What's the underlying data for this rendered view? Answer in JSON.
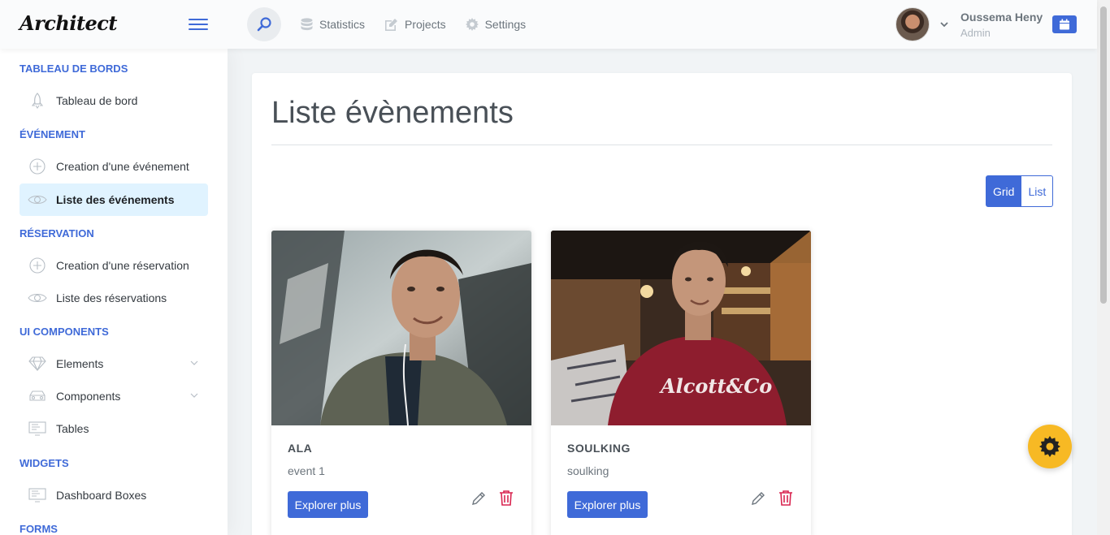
{
  "app": {
    "logo": "Architect"
  },
  "header": {
    "nav": [
      {
        "label": "Statistics",
        "icon": "database-icon"
      },
      {
        "label": "Projects",
        "icon": "edit-icon"
      },
      {
        "label": "Settings",
        "icon": "gear-icon"
      }
    ],
    "user": {
      "name": "Oussema Heny",
      "role": "Admin"
    }
  },
  "sidebar": {
    "sections": [
      {
        "title": "TABLEAU DE BORDS",
        "items": [
          {
            "label": "Tableau de bord",
            "icon": "rocket-icon"
          }
        ]
      },
      {
        "title": "ÉVÉNEMENT",
        "items": [
          {
            "label": "Creation d'une événement",
            "icon": "plus-circle-icon"
          },
          {
            "label": "Liste des événements",
            "icon": "eye-icon",
            "active": true
          }
        ]
      },
      {
        "title": "RÉSERVATION",
        "items": [
          {
            "label": "Creation d'une réservation",
            "icon": "plus-circle-icon"
          },
          {
            "label": "Liste des réservations",
            "icon": "eye-icon"
          }
        ]
      },
      {
        "title": "UI COMPONENTS",
        "items": [
          {
            "label": "Elements",
            "icon": "diamond-icon"
          },
          {
            "label": "Components",
            "icon": "car-icon"
          },
          {
            "label": "Tables",
            "icon": "monitor-icon"
          }
        ]
      },
      {
        "title": "WIDGETS",
        "items": [
          {
            "label": "Dashboard Boxes",
            "icon": "monitor-icon"
          }
        ]
      },
      {
        "title": "FORMS",
        "items": []
      }
    ]
  },
  "main": {
    "title": "Liste évènements",
    "view_toggle": {
      "grid": "Grid",
      "list": "List",
      "selected": "Grid"
    },
    "events": [
      {
        "name": "ALA",
        "description": "event 1",
        "button": "Explorer plus"
      },
      {
        "name": "SOULKING",
        "description": "soulking",
        "button": "Explorer plus"
      }
    ]
  },
  "colors": {
    "accent": "#3f6ad8",
    "active_bg": "#e0f3ff",
    "fab": "#f7b924",
    "danger": "#d92550"
  }
}
